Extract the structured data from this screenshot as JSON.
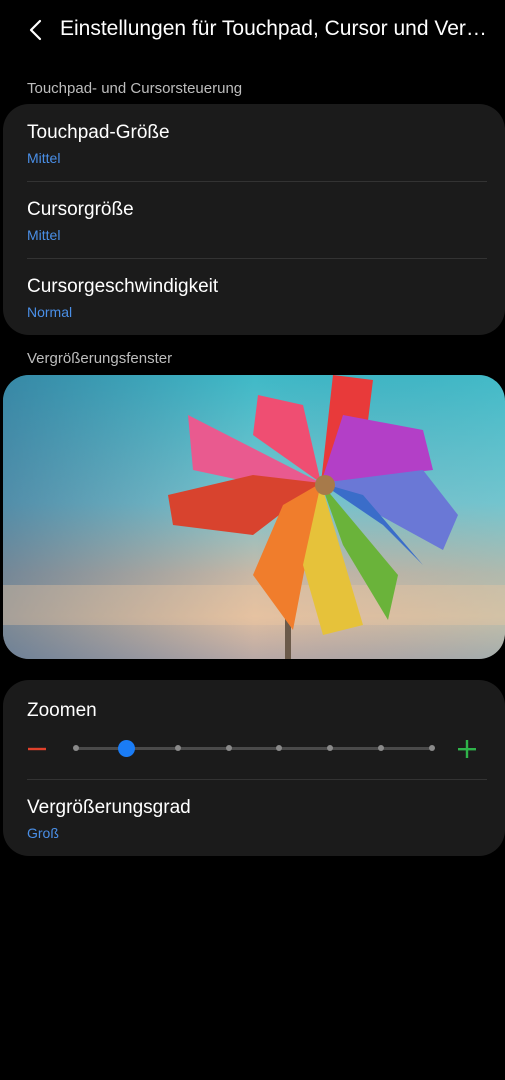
{
  "header": {
    "title": "Einstellungen für Touchpad, Cursor und Vergrößerung",
    "back_icon": "chevron-left-icon"
  },
  "touchpad_section": {
    "label": "Touchpad- und Cursorsteuerung",
    "items": [
      {
        "title": "Touchpad-Größe",
        "value": "Mittel"
      },
      {
        "title": "Cursorgröße",
        "value": "Mittel"
      },
      {
        "title": "Cursorgeschwindigkeit",
        "value": "Normal"
      }
    ]
  },
  "magnifier_section": {
    "label": "Vergrößerungsfenster",
    "preview_image": "colorful-pinwheel-photo"
  },
  "zoom": {
    "title": "Zoomen",
    "minus_icon": "minus-icon",
    "plus_icon": "plus-icon",
    "steps": 8,
    "current_step": 2,
    "minus_color": "#e0412b",
    "plus_color": "#2fb34a",
    "accent": "#1a7cf5"
  },
  "magnification": {
    "title": "Vergrößerungsgrad",
    "value": "Groß"
  }
}
